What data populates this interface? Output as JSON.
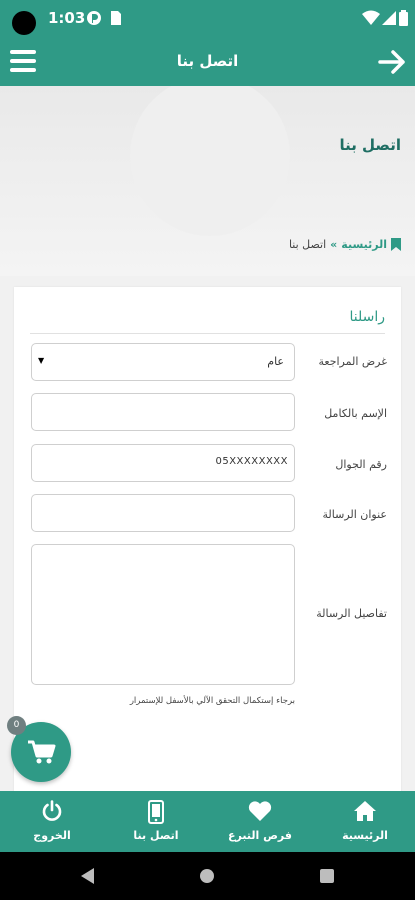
{
  "status_bar": {
    "time": "1:03"
  },
  "app_bar": {
    "title": "اتصل بنا"
  },
  "page": {
    "title": "اتصل بنا"
  },
  "breadcrumb": {
    "home": "الرئيسية",
    "separator": "»",
    "current": "اتصل بنا"
  },
  "form": {
    "heading": "راسلنا",
    "purpose_label": "غرض المراجعة",
    "purpose_value": "عام",
    "fullname_label": "الإسم بالكامل",
    "fullname_value": "",
    "mobile_label": "رقم الجوال",
    "mobile_placeholder": "05XXXXXXXX",
    "subject_label": "عنوان الرسالة",
    "subject_value": "",
    "details_label": "تفاصيل الرسالة",
    "details_value": "",
    "note": "برجاء إستكمال التحقق الآلي بالأسفل للإستمرار"
  },
  "cart": {
    "count": "0"
  },
  "bottom_nav": {
    "items": [
      {
        "label": "الرئيسية",
        "icon": "home-icon"
      },
      {
        "label": "فرص التبرع",
        "icon": "heart-icon"
      },
      {
        "label": "اتصل بنا",
        "icon": "mobile-icon"
      },
      {
        "label": "الخروج",
        "icon": "power-icon"
      }
    ]
  },
  "colors": {
    "primary": "#2f9a86",
    "title": "#1f6e63",
    "background": "#f1f1f1"
  }
}
